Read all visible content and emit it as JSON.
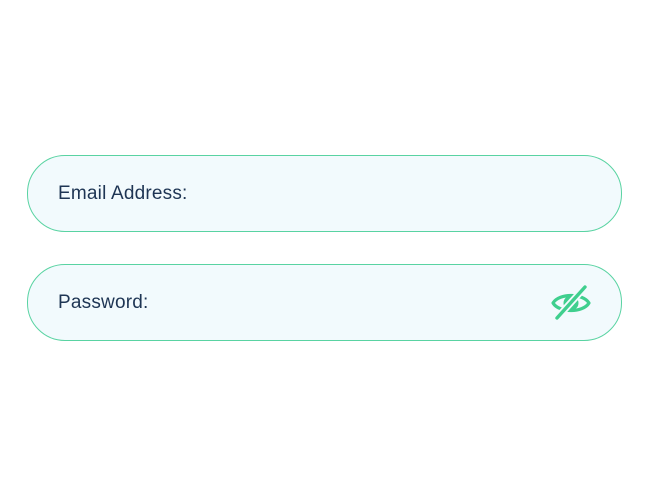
{
  "colors": {
    "accent": "#3fcf8e",
    "border": "#59d3a2",
    "field_bg": "#f2fafd",
    "label_text": "#1e3554"
  },
  "email": {
    "label": "Email Address:",
    "value": ""
  },
  "password": {
    "label": "Password:",
    "value": "",
    "toggle_icon": "eye-off-icon"
  }
}
